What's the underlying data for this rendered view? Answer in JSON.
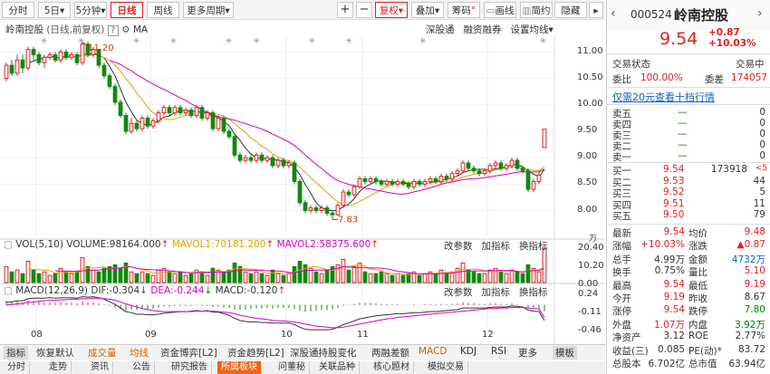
{
  "toolbar": {
    "periods": [
      "分时",
      "5日",
      "5分钟",
      "日线",
      "周线",
      "更多周期"
    ],
    "active_period": "日线",
    "buttons": [
      "复权",
      "叠加",
      "筹码",
      "画线",
      "简约",
      "隐藏"
    ]
  },
  "chart_header": {
    "name": "岭南控股",
    "mode": "(日线,前复权)",
    "help": "?",
    "indicator": "MA",
    "links": [
      "深股通",
      "融资融券",
      "设置均线"
    ]
  },
  "price_axis": {
    "labels": [
      "11.00",
      "10.50",
      "10.00",
      "9.50",
      "9.00",
      "8.50",
      "8.00"
    ]
  },
  "annotations": {
    "high": "11.20",
    "low": "7.83"
  },
  "vol_header": {
    "name": "VOL(5,10)",
    "volume": "VOLUME:98164.000",
    "mavol1": "MAVOL1:70181.200",
    "mavol2": "MAVOL2:58375.600",
    "actions": [
      "改参数",
      "加指标",
      "换指标"
    ]
  },
  "vol_axis": {
    "labels": [
      "20.40",
      "10.20",
      "0.00"
    ],
    "unit": "万"
  },
  "macd_header": {
    "name": "MACD(12,26,9)",
    "dif": "DIF:-0.304",
    "dea": "DEA:-0.244",
    "macd": "MACD:-0.120",
    "actions": [
      "改参数",
      "加指标",
      "换指标"
    ]
  },
  "macd_axis": {
    "labels": [
      "0.24",
      "-0.11",
      "-0.46"
    ]
  },
  "months": [
    "08",
    "09",
    "10",
    "11",
    "12"
  ],
  "indicator_tabs": [
    "指标",
    "恢复默认",
    "成交量",
    "均线",
    "资金博弈[L2]",
    "资金趋势[L2]",
    "深股通持股变化",
    "两融差额",
    "MACD",
    "KDJ",
    "RSI",
    "更多",
    "模板"
  ],
  "bottom_tabs": [
    "分时",
    "走势",
    "资讯",
    "公告",
    "研究报告",
    "所属板块",
    "问董秘",
    "关联品种",
    "核心题材",
    "模拟交易"
  ],
  "active_bottom_tab": "所属板块",
  "stock": {
    "code": "000524",
    "name": "岭南控股",
    "price": "9.54",
    "change": "+0.87",
    "pct": "+10.03%"
  },
  "status": {
    "label": "交易状态",
    "value": "交易中"
  },
  "ratio": {
    "wb_label": "委比",
    "wb": "100.00%",
    "wc_label": "委差",
    "wc": "174057"
  },
  "ten_level_link": "仅需20元查看十档行情",
  "asks": [
    {
      "label": "卖五",
      "price": "—",
      "vol": "0"
    },
    {
      "label": "卖四",
      "price": "—",
      "vol": "0"
    },
    {
      "label": "卖三",
      "price": "—",
      "vol": "0"
    },
    {
      "label": "卖二",
      "price": "—",
      "vol": "0"
    },
    {
      "label": "卖一",
      "price": "—",
      "vol": "0"
    }
  ],
  "bids": [
    {
      "label": "买一",
      "price": "9.54",
      "vol": "173918",
      "extra": "<5"
    },
    {
      "label": "买二",
      "price": "9.53",
      "vol": "44"
    },
    {
      "label": "买三",
      "price": "9.52",
      "vol": "5"
    },
    {
      "label": "买四",
      "price": "9.51",
      "vol": "11"
    },
    {
      "label": "买五",
      "price": "9.50",
      "vol": "79"
    }
  ],
  "quote": [
    {
      "l1": "最新",
      "v1": "9.54",
      "c1": "red",
      "l2": "均价",
      "v2": "9.48",
      "c2": "red"
    },
    {
      "l1": "涨幅",
      "v1": "+10.03%",
      "c1": "red",
      "l2": "涨跌",
      "v2": "▲0.87",
      "c2": "red"
    },
    {
      "l1": "总手",
      "v1": "4.99万",
      "c1": "",
      "l2": "金额",
      "v2": "4732万",
      "c2": "blu"
    },
    {
      "l1": "换手",
      "v1": "0.75%",
      "c1": "",
      "l2": "量比",
      "v2": "5.10",
      "c2": "red"
    },
    {
      "l1": "最高",
      "v1": "9.54",
      "c1": "red",
      "l2": "最低",
      "v2": "9.19",
      "c2": "red"
    },
    {
      "l1": "今开",
      "v1": "9.19",
      "c1": "red",
      "l2": "昨收",
      "v2": "8.67",
      "c2": ""
    },
    {
      "l1": "涨停",
      "v1": "9.54",
      "c1": "red",
      "l2": "跌停",
      "v2": "7.80",
      "c2": "grn"
    },
    {
      "l1": "外盘",
      "v1": "1.07万",
      "c1": "red",
      "l2": "内盘",
      "v2": "3.92万",
      "c2": "grn"
    },
    {
      "l1": "净资产",
      "v1": "3.12",
      "c1": "",
      "l2": "ROE",
      "v2": "2.77%",
      "c2": ""
    },
    {
      "l1": "收益(三)",
      "v1": "0.085",
      "c1": "",
      "l2": "PE(动)*",
      "v2": "83.72",
      "c2": ""
    },
    {
      "l1": "总股本",
      "v1": "6.702亿",
      "c1": "",
      "l2": "总市值",
      "v2": "63.94亿",
      "c2": ""
    }
  ],
  "colors": {
    "up": "#e02020",
    "down": "#108810",
    "ma5": "#333333",
    "ma10": "#e8a000",
    "ma20": "#d000d0",
    "accent": "#f06414"
  },
  "chart_data": {
    "type": "candlestick",
    "ylim": [
      7.7,
      11.3
    ],
    "candles": [
      [
        10.5,
        10.75,
        10.8,
        10.45
      ],
      [
        10.75,
        10.6,
        10.85,
        10.55
      ],
      [
        10.6,
        10.85,
        10.95,
        10.55
      ],
      [
        10.85,
        10.7,
        10.95,
        10.6
      ],
      [
        10.7,
        11.05,
        11.1,
        10.65
      ],
      [
        11.05,
        10.95,
        11.1,
        10.85
      ],
      [
        10.95,
        10.8,
        11.0,
        10.75
      ],
      [
        10.8,
        10.9,
        10.95,
        10.7
      ],
      [
        10.9,
        10.95,
        11.0,
        10.85
      ],
      [
        10.95,
        10.85,
        11.0,
        10.8
      ],
      [
        10.85,
        11.0,
        11.05,
        10.8
      ],
      [
        11.0,
        10.9,
        11.05,
        10.85
      ],
      [
        10.9,
        10.95,
        11.0,
        10.85
      ],
      [
        10.95,
        10.8,
        11.0,
        10.75
      ],
      [
        10.8,
        11.15,
        11.2,
        10.75
      ],
      [
        11.15,
        10.95,
        11.2,
        10.9
      ],
      [
        10.95,
        11.05,
        11.1,
        10.9
      ],
      [
        11.05,
        10.75,
        11.05,
        10.7
      ],
      [
        10.75,
        10.55,
        10.8,
        10.5
      ],
      [
        10.55,
        10.35,
        10.6,
        10.3
      ],
      [
        10.35,
        10.05,
        10.4,
        10.0
      ],
      [
        10.05,
        9.8,
        10.1,
        9.75
      ],
      [
        9.8,
        9.5,
        9.85,
        9.45
      ],
      [
        9.5,
        9.65,
        9.75,
        9.45
      ],
      [
        9.65,
        9.55,
        9.7,
        9.5
      ],
      [
        9.55,
        9.75,
        9.8,
        9.5
      ],
      [
        9.75,
        9.6,
        9.8,
        9.55
      ],
      [
        9.6,
        9.7,
        9.75,
        9.55
      ],
      [
        9.7,
        9.85,
        9.9,
        9.65
      ],
      [
        9.85,
        9.95,
        10.0,
        9.8
      ],
      [
        9.95,
        9.85,
        10.0,
        9.8
      ],
      [
        9.85,
        9.95,
        10.0,
        9.8
      ],
      [
        9.95,
        9.85,
        10.0,
        9.8
      ],
      [
        9.85,
        9.9,
        9.95,
        9.8
      ],
      [
        9.9,
        9.8,
        9.95,
        9.75
      ],
      [
        9.8,
        9.95,
        10.0,
        9.75
      ],
      [
        9.95,
        9.75,
        10.0,
        9.7
      ],
      [
        9.75,
        9.85,
        9.9,
        9.7
      ],
      [
        9.85,
        9.55,
        9.9,
        9.5
      ],
      [
        9.55,
        9.75,
        9.8,
        9.5
      ],
      [
        9.75,
        9.5,
        9.8,
        9.45
      ],
      [
        9.5,
        9.4,
        9.55,
        9.35
      ],
      [
        9.4,
        9.05,
        9.45,
        9.0
      ],
      [
        9.05,
        8.95,
        9.1,
        8.9
      ],
      [
        8.95,
        9.0,
        9.05,
        8.9
      ],
      [
        9.0,
        8.95,
        9.05,
        8.9
      ],
      [
        8.95,
        9.05,
        9.1,
        8.9
      ],
      [
        9.05,
        8.95,
        9.1,
        8.9
      ],
      [
        8.95,
        9.0,
        9.05,
        8.9
      ],
      [
        9.0,
        8.85,
        9.05,
        8.8
      ],
      [
        8.85,
        8.95,
        9.0,
        8.8
      ],
      [
        8.95,
        8.85,
        9.0,
        8.8
      ],
      [
        8.85,
        8.9,
        8.95,
        8.8
      ],
      [
        8.9,
        8.55,
        8.95,
        8.5
      ],
      [
        8.55,
        8.15,
        8.6,
        8.1
      ],
      [
        8.15,
        8.0,
        8.2,
        7.95
      ],
      [
        8.0,
        8.05,
        8.1,
        7.95
      ],
      [
        8.05,
        8.0,
        8.1,
        7.95
      ],
      [
        8.0,
        8.05,
        8.1,
        7.95
      ],
      [
        8.05,
        7.95,
        8.1,
        7.9
      ],
      [
        7.95,
        7.92,
        8.0,
        7.83
      ],
      [
        7.92,
        8.1,
        8.15,
        7.9
      ],
      [
        8.1,
        8.35,
        8.4,
        8.05
      ],
      [
        8.35,
        8.3,
        8.4,
        8.25
      ],
      [
        8.3,
        8.45,
        8.5,
        8.25
      ],
      [
        8.45,
        8.6,
        8.65,
        8.4
      ],
      [
        8.6,
        8.55,
        8.65,
        8.5
      ],
      [
        8.55,
        8.6,
        8.65,
        8.5
      ],
      [
        8.6,
        8.55,
        8.65,
        8.5
      ],
      [
        8.55,
        8.5,
        8.6,
        8.45
      ],
      [
        8.5,
        8.55,
        8.6,
        8.45
      ],
      [
        8.55,
        8.5,
        8.6,
        8.45
      ],
      [
        8.5,
        8.55,
        8.6,
        8.45
      ],
      [
        8.55,
        8.5,
        8.6,
        8.45
      ],
      [
        8.5,
        8.45,
        8.55,
        8.4
      ],
      [
        8.45,
        8.55,
        8.6,
        8.4
      ],
      [
        8.55,
        8.5,
        8.6,
        8.45
      ],
      [
        8.5,
        8.55,
        8.6,
        8.45
      ],
      [
        8.55,
        8.6,
        8.65,
        8.5
      ],
      [
        8.6,
        8.55,
        8.65,
        8.5
      ],
      [
        8.55,
        8.65,
        8.7,
        8.5
      ],
      [
        8.65,
        8.6,
        8.7,
        8.55
      ],
      [
        8.6,
        8.7,
        8.75,
        8.55
      ],
      [
        8.7,
        8.75,
        8.8,
        8.65
      ],
      [
        8.75,
        8.9,
        8.95,
        8.7
      ],
      [
        8.9,
        8.8,
        8.95,
        8.75
      ],
      [
        8.8,
        8.75,
        8.85,
        8.7
      ],
      [
        8.75,
        8.7,
        8.8,
        8.65
      ],
      [
        8.7,
        8.75,
        8.8,
        8.65
      ],
      [
        8.75,
        8.85,
        8.9,
        8.7
      ],
      [
        8.85,
        8.9,
        8.95,
        8.8
      ],
      [
        8.9,
        8.8,
        8.95,
        8.75
      ],
      [
        8.8,
        8.85,
        8.9,
        8.75
      ],
      [
        8.85,
        8.95,
        9.0,
        8.8
      ],
      [
        8.95,
        8.8,
        9.0,
        8.75
      ],
      [
        8.8,
        8.75,
        8.85,
        8.7
      ],
      [
        8.75,
        8.4,
        8.8,
        8.35
      ],
      [
        8.4,
        8.55,
        8.6,
        8.35
      ],
      [
        8.55,
        8.67,
        8.75,
        8.5
      ],
      [
        9.19,
        9.54,
        9.54,
        9.19
      ]
    ],
    "volume": [
      9,
      6,
      7,
      5,
      12,
      7,
      5,
      6,
      4,
      5,
      8,
      6,
      5,
      6,
      14,
      9,
      7,
      6,
      8,
      9,
      10,
      8,
      11,
      6,
      5,
      6,
      5,
      4,
      7,
      8,
      6,
      5,
      6,
      4,
      5,
      7,
      6,
      4,
      8,
      7,
      6,
      7,
      11,
      9,
      6,
      5,
      6,
      5,
      4,
      7,
      5,
      4,
      5,
      9,
      12,
      10,
      8,
      6,
      5,
      7,
      9,
      10,
      13,
      7,
      9,
      11,
      6,
      5,
      5,
      6,
      5,
      4,
      5,
      4,
      5,
      6,
      4,
      5,
      6,
      5,
      7,
      5,
      6,
      8,
      11,
      7,
      6,
      5,
      5,
      7,
      8,
      6,
      5,
      7,
      6,
      5,
      10,
      8,
      6,
      19
    ],
    "macd_hist": [
      0.08,
      0.06,
      0.07,
      0.05,
      0.08,
      0.07,
      0.06,
      0.05,
      0.05,
      0.04,
      0.05,
      0.04,
      0.04,
      0.03,
      0.06,
      0.05,
      0.05,
      0.03,
      0.01,
      -0.02,
      -0.05,
      -0.08,
      -0.11,
      -0.1,
      -0.1,
      -0.08,
      -0.08,
      -0.07,
      -0.05,
      -0.03,
      -0.03,
      -0.02,
      -0.02,
      -0.02,
      -0.02,
      -0.01,
      -0.02,
      -0.02,
      -0.04,
      -0.03,
      -0.05,
      -0.06,
      -0.09,
      -0.1,
      -0.09,
      -0.08,
      -0.07,
      -0.07,
      -0.06,
      -0.07,
      -0.06,
      -0.06,
      -0.06,
      -0.08,
      -0.11,
      -0.13,
      -0.12,
      -0.11,
      -0.1,
      -0.1,
      -0.09,
      -0.06,
      -0.02,
      0.0,
      0.02,
      0.04,
      0.04,
      0.04,
      0.03,
      0.02,
      0.02,
      0.01,
      0.01,
      0.0,
      0.0,
      0.01,
      0.0,
      0.01,
      0.01,
      0.01,
      0.02,
      0.01,
      0.02,
      0.03,
      0.05,
      0.04,
      0.03,
      0.02,
      0.02,
      0.03,
      0.03,
      0.02,
      0.02,
      0.03,
      0.01,
      0.0,
      -0.05,
      -0.06,
      -0.08,
      -0.12
    ],
    "dif": [
      0.05,
      0.06,
      0.08,
      0.08,
      0.12,
      0.13,
      0.13,
      0.13,
      0.14,
      0.13,
      0.14,
      0.14,
      0.14,
      0.13,
      0.16,
      0.15,
      0.16,
      0.14,
      0.11,
      0.06,
      0.01,
      -0.06,
      -0.13,
      -0.15,
      -0.18,
      -0.18,
      -0.19,
      -0.19,
      -0.18,
      -0.16,
      -0.15,
      -0.14,
      -0.13,
      -0.13,
      -0.12,
      -0.11,
      -0.12,
      -0.11,
      -0.14,
      -0.14,
      -0.17,
      -0.2,
      -0.26,
      -0.3,
      -0.32,
      -0.33,
      -0.33,
      -0.34,
      -0.34,
      -0.35,
      -0.35,
      -0.35,
      -0.35,
      -0.38,
      -0.43,
      -0.47,
      -0.48,
      -0.48,
      -0.48,
      -0.48,
      -0.47,
      -0.43,
      -0.38,
      -0.35,
      -0.31,
      -0.27,
      -0.25,
      -0.23,
      -0.21,
      -0.2,
      -0.19,
      -0.18,
      -0.17,
      -0.17,
      -0.16,
      -0.15,
      -0.15,
      -0.14,
      -0.13,
      -0.13,
      -0.12,
      -0.11,
      -0.1,
      -0.09,
      -0.06,
      -0.06,
      -0.06,
      -0.06,
      -0.06,
      -0.05,
      -0.04,
      -0.04,
      -0.04,
      -0.02,
      -0.03,
      -0.04,
      -0.1,
      -0.12,
      -0.13,
      -0.3
    ],
    "dea": [
      0.0,
      0.01,
      0.02,
      0.03,
      0.05,
      0.06,
      0.07,
      0.08,
      0.09,
      0.09,
      0.1,
      0.1,
      0.11,
      0.11,
      0.12,
      0.12,
      0.13,
      0.13,
      0.12,
      0.11,
      0.09,
      0.06,
      0.02,
      -0.01,
      -0.04,
      -0.07,
      -0.09,
      -0.11,
      -0.12,
      -0.13,
      -0.13,
      -0.13,
      -0.13,
      -0.13,
      -0.13,
      -0.12,
      -0.12,
      -0.12,
      -0.12,
      -0.13,
      -0.14,
      -0.15,
      -0.17,
      -0.2,
      -0.22,
      -0.24,
      -0.26,
      -0.27,
      -0.28,
      -0.3,
      -0.31,
      -0.31,
      -0.32,
      -0.33,
      -0.35,
      -0.37,
      -0.39,
      -0.41,
      -0.42,
      -0.43,
      -0.44,
      -0.44,
      -0.43,
      -0.41,
      -0.39,
      -0.37,
      -0.35,
      -0.33,
      -0.31,
      -0.29,
      -0.27,
      -0.26,
      -0.24,
      -0.23,
      -0.22,
      -0.21,
      -0.2,
      -0.19,
      -0.18,
      -0.17,
      -0.16,
      -0.15,
      -0.14,
      -0.13,
      -0.12,
      -0.11,
      -0.1,
      -0.09,
      -0.08,
      -0.07,
      -0.07,
      -0.06,
      -0.06,
      -0.05,
      -0.05,
      -0.05,
      -0.06,
      -0.07,
      -0.08,
      -0.24
    ]
  }
}
